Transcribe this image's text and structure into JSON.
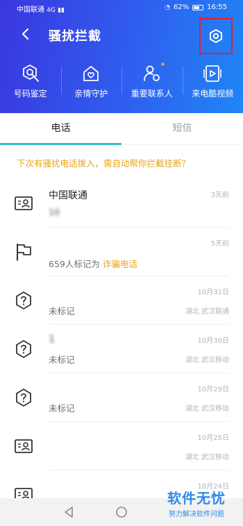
{
  "status_bar": {
    "carrier": "中国联通",
    "network": "4G",
    "battery": "62%",
    "time": "16:55"
  },
  "header": {
    "title": "骚扰拦截",
    "back_icon": "back-arrow-icon",
    "settings_icon": "settings-hexagon-icon"
  },
  "features": [
    {
      "label": "号码鉴定",
      "icon": "number-check-icon"
    },
    {
      "label": "亲情守护",
      "icon": "family-guard-icon"
    },
    {
      "label": "重要联系人",
      "icon": "important-contact-icon",
      "has_dot": true
    },
    {
      "label": "来电酷视频",
      "icon": "call-video-icon"
    }
  ],
  "tabs": [
    {
      "label": "电话",
      "active": true
    },
    {
      "label": "短信",
      "active": false
    }
  ],
  "notice": "下次有骚扰电话拨入，需自动帮你拦截挂断？",
  "calls": [
    {
      "icon": "contact-card-icon",
      "title": "中国联通",
      "subtitle": "10",
      "tag": "",
      "time": "3天前",
      "location": ""
    },
    {
      "icon": "flag-icon",
      "title": "",
      "subtitle": "659人标记为",
      "tag": "诈骗电话",
      "time": "5天前",
      "location": ""
    },
    {
      "icon": "unknown-hexagon-icon",
      "title": "",
      "subtitle": "未标记",
      "tag": "",
      "time": "10月31日",
      "location": "湖北 武汉联通"
    },
    {
      "icon": "unknown-hexagon-icon",
      "title": "1",
      "subtitle": "未标记",
      "tag": "",
      "time": "10月30日",
      "location": "湖北 武汉移动"
    },
    {
      "icon": "unknown-hexagon-icon",
      "title": "",
      "subtitle": "未标记",
      "tag": "",
      "time": "10月29日",
      "location": "湖北 武汉移动"
    },
    {
      "icon": "contact-card-icon",
      "title": "",
      "subtitle": "",
      "tag": "",
      "time": "10月25日",
      "location": "湖北 武汉移动"
    },
    {
      "icon": "contact-card-icon",
      "title": "",
      "subtitle": "",
      "tag": "",
      "time": "10月24日",
      "location": ""
    }
  ],
  "watermark": {
    "main": "软件无忧",
    "sub": "努力解决软件问题"
  },
  "colors": {
    "header_gradient_start": "#3a37e0",
    "header_gradient_end": "#1f86f5",
    "accent_teal": "#2fc3d0",
    "warning_orange": "#e8a317",
    "highlight_red": "#e0202c"
  }
}
